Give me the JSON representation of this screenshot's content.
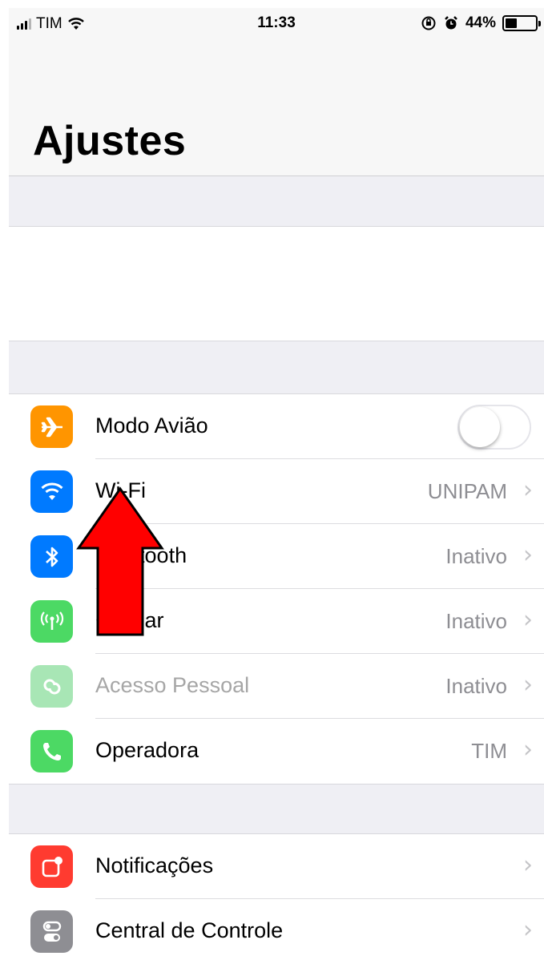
{
  "status_bar": {
    "carrier": "TIM",
    "time": "11:33",
    "battery_percent": "44%",
    "battery_level": 0.44
  },
  "header": {
    "title": "Ajustes"
  },
  "groups": [
    {
      "rows": [
        {
          "label": "Modo Avião",
          "control": "toggle",
          "toggle_on": false,
          "icon": "airplane-icon",
          "icon_color": "#ff9500"
        },
        {
          "label": "Wi-Fi",
          "value": "UNIPAM",
          "icon": "wifi-icon",
          "icon_color": "#007aff"
        },
        {
          "label": "Bluetooth",
          "value": "Inativo",
          "icon": "bluetooth-icon",
          "icon_color": "#007aff"
        },
        {
          "label": "Celular",
          "value": "Inativo",
          "icon": "cellular-antenna-icon",
          "icon_color": "#4cd964"
        },
        {
          "label": "Acesso Pessoal",
          "value": "Inativo",
          "icon": "personal-hotspot-icon",
          "icon_color": "#a8e6b5",
          "disabled": true
        },
        {
          "label": "Operadora",
          "value": "TIM",
          "icon": "phone-icon",
          "icon_color": "#4cd964"
        }
      ]
    },
    {
      "rows": [
        {
          "label": "Notificações",
          "icon": "notifications-icon",
          "icon_color": "#ff3b30"
        },
        {
          "label": "Central de Controle",
          "icon": "control-center-icon",
          "icon_color": "#8e8e93"
        }
      ]
    }
  ],
  "annotation": {
    "type": "arrow",
    "color": "#ff0000",
    "points_to": "Wi-Fi"
  }
}
